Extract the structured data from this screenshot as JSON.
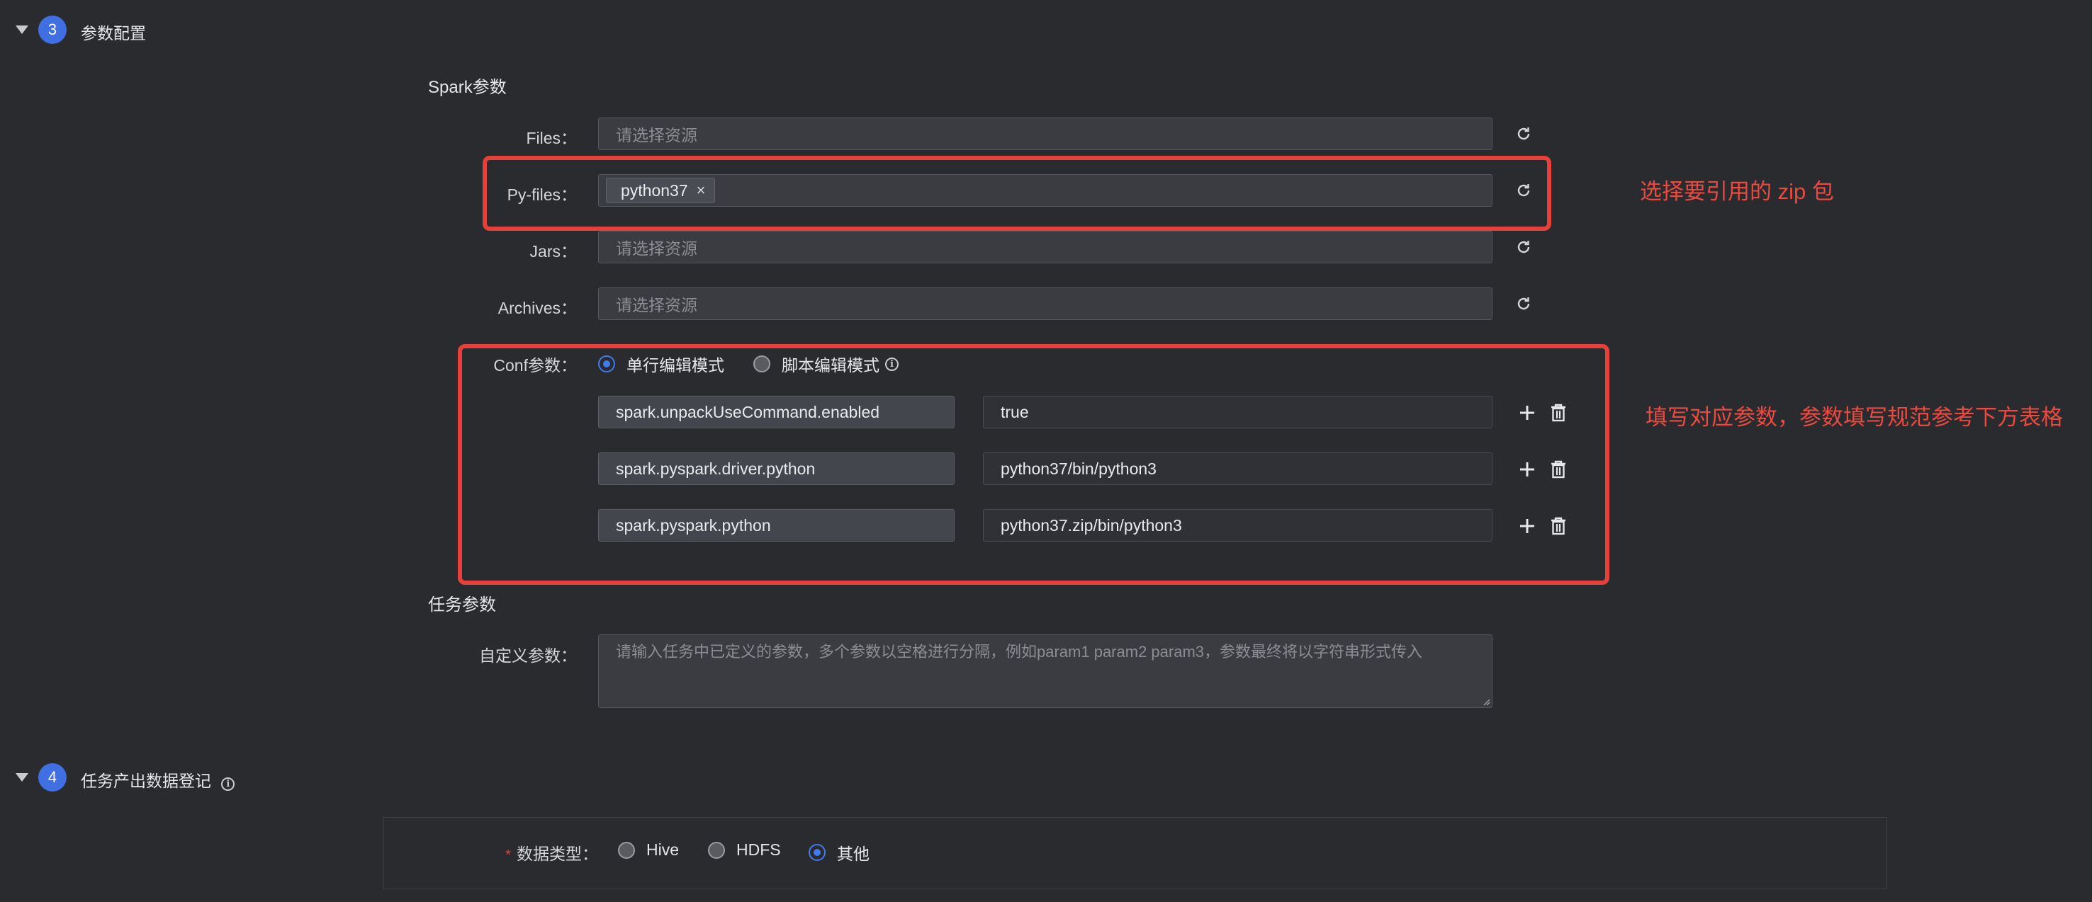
{
  "section3": {
    "step": "3",
    "title": "参数配置"
  },
  "spark_params": {
    "title": "Spark参数",
    "files": {
      "label": "Files：",
      "placeholder": "请选择资源"
    },
    "py_files": {
      "label": "Py-files：",
      "tag": "python37",
      "tag_close": "×"
    },
    "jars": {
      "label": "Jars：",
      "placeholder": "请选择资源"
    },
    "archives": {
      "label": "Archives：",
      "placeholder": "请选择资源"
    },
    "conf": {
      "label": "Conf参数：",
      "mode_single": "单行编辑模式",
      "mode_script": "脚本编辑模式",
      "selected_mode": "单行编辑模式",
      "rows": [
        {
          "key": "spark.unpackUseCommand.enabled",
          "value": "true"
        },
        {
          "key": "spark.pyspark.driver.python",
          "value": "python37/bin/python3"
        },
        {
          "key": "spark.pyspark.python",
          "value": "python37.zip/bin/python3"
        }
      ]
    }
  },
  "task_params": {
    "title": "任务参数",
    "custom": {
      "label": "自定义参数：",
      "placeholder": "请输入任务中已定义的参数，多个参数以空格进行分隔，例如param1 param2 param3，参数最终将以字符串形式传入"
    }
  },
  "annotations": {
    "pyfiles_note": "选择要引用的 zip 包",
    "conf_note": "填写对应参数，参数填写规范参考下方表格"
  },
  "section4": {
    "step": "4",
    "title": "任务产出数据登记",
    "data_type": {
      "label": "数据类型：",
      "required": "*",
      "options": [
        "Hive",
        "HDFS",
        "其他"
      ],
      "selected": "其他"
    }
  },
  "colors": {
    "background": "#2a2b2f",
    "accent": "#3f7af0",
    "annotation_red": "#e5413a"
  }
}
